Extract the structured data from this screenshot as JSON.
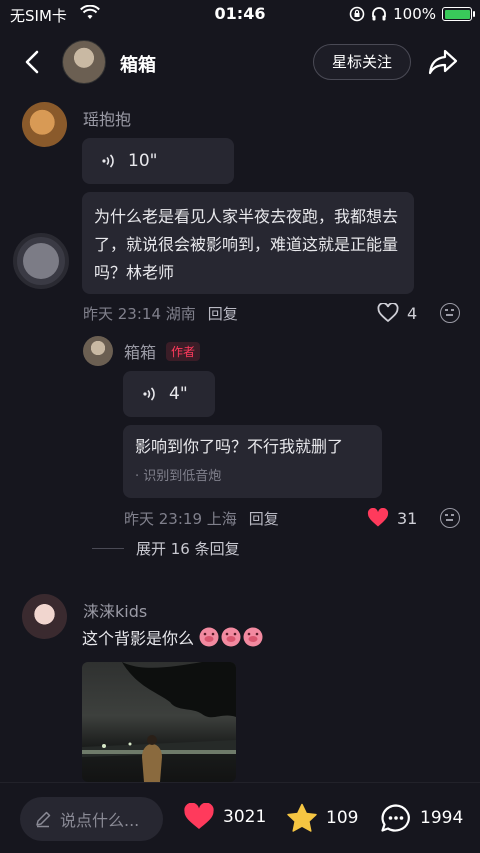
{
  "status": {
    "carrier": "无SIM卡",
    "time": "01:46",
    "battery": "100%"
  },
  "header": {
    "name": "箱箱",
    "star_follow": "星标关注"
  },
  "comments": {
    "c1": {
      "username": "瑶抱抱",
      "voice": "10\"",
      "text": "为什么老是看见人家半夜去夜跑，我都想去了，就说很会被影响到，难道这就是正能量吗？林老师",
      "time": "昨天 23:14 湖南",
      "reply": "回复",
      "likes": "4"
    },
    "r1": {
      "username": "箱箱",
      "badge": "作者",
      "voice": "4\"",
      "text": "影响到你了吗？不行我就删了",
      "recognized": "· 识别到低音炮",
      "time": "昨天 23:19 上海",
      "reply": "回复",
      "likes": "31"
    },
    "expand": "展开 16 条回复",
    "c2": {
      "username": "涞涞kids",
      "text": "这个背影是你么"
    }
  },
  "bottom": {
    "placeholder": "说点什么...",
    "likes": "3021",
    "stars": "109",
    "comments": "1994"
  },
  "colors": {
    "accent_red": "#ff3a5c",
    "star_yellow": "#f5c542",
    "bg": "#16161e"
  }
}
